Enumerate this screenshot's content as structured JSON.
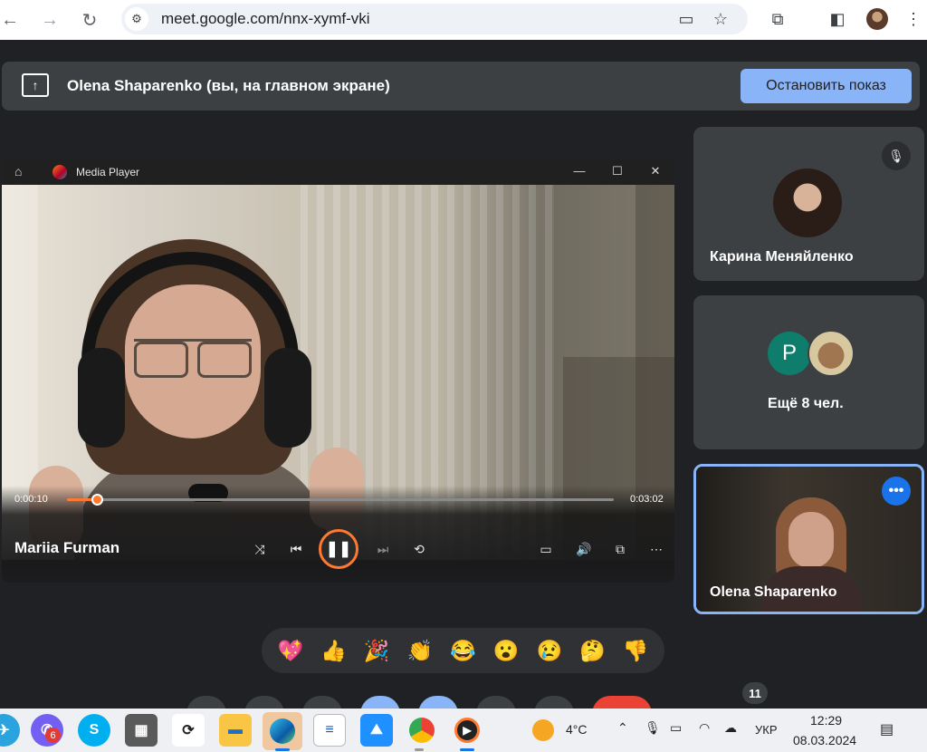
{
  "browser": {
    "url": "meet.google.com/nnx-xymf-vki"
  },
  "presenting": {
    "text": "Olena Shaparenko (вы, на главном экране)",
    "stop_label": "Остановить показ"
  },
  "media_player": {
    "title": "Media Player",
    "current_time": "0:00:10",
    "total_time": "0:03:02",
    "progress": 0.055,
    "speaker": "Mariia Furman"
  },
  "participants": {
    "tile1_name": "Карина Меняйленко",
    "tile2_avatar_letter": "P",
    "tile2_more": "Ещё 8 чел.",
    "self_name": "Olena Shaparenko"
  },
  "reactions": [
    "💖",
    "👍",
    "🎉",
    "👏",
    "😂",
    "😮",
    "😢",
    "🤔",
    "👎"
  ],
  "participant_count": "11",
  "taskbar": {
    "viber_badge": "6",
    "weather": "4°C",
    "language": "УКР",
    "time": "12:29",
    "date": "08.03.2024"
  }
}
